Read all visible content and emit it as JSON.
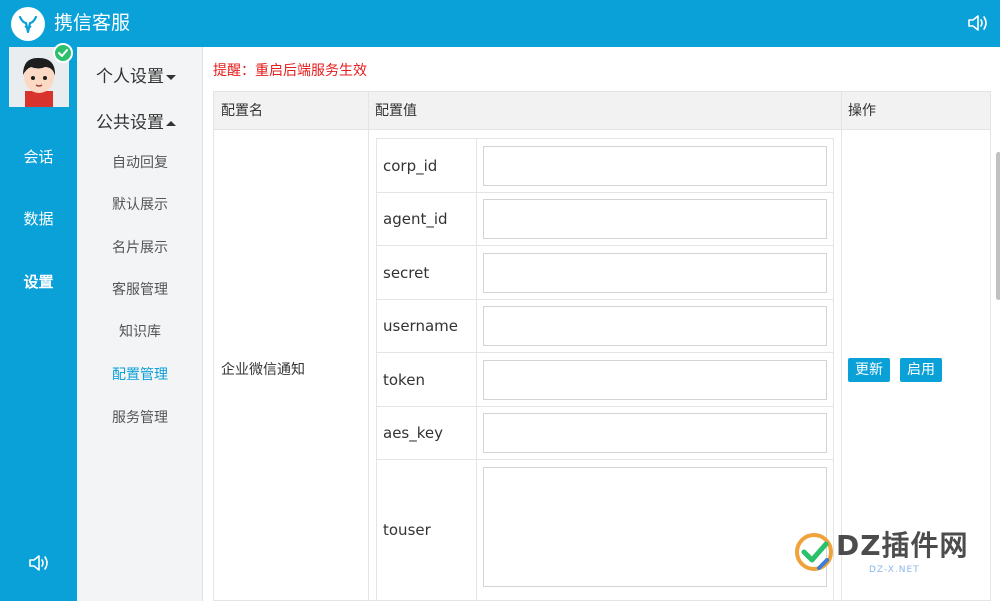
{
  "app": {
    "title": "携信客服"
  },
  "left_rail": {
    "items": [
      {
        "label": "会话"
      },
      {
        "label": "数据"
      },
      {
        "label": "设置"
      }
    ]
  },
  "submenu": {
    "group_personal": "个人设置",
    "group_public": "公共设置",
    "items": [
      {
        "label": "自动回复"
      },
      {
        "label": "默认展示"
      },
      {
        "label": "名片展示"
      },
      {
        "label": "客服管理"
      },
      {
        "label": "知识库"
      },
      {
        "label": "配置管理"
      },
      {
        "label": "服务管理"
      }
    ],
    "active": "配置管理"
  },
  "main": {
    "notice": "提醒：重启后端服务生效",
    "table": {
      "headers": [
        "配置名",
        "配置值",
        "操作"
      ],
      "row_name": "企业微信通知",
      "fields": [
        {
          "label": "corp_id",
          "value": ""
        },
        {
          "label": "agent_id",
          "value": ""
        },
        {
          "label": "secret",
          "value": ""
        },
        {
          "label": "username",
          "value": ""
        },
        {
          "label": "token",
          "value": ""
        },
        {
          "label": "aes_key",
          "value": ""
        },
        {
          "label": "touser",
          "value": ""
        }
      ],
      "actions": {
        "update": "更新",
        "enable": "启用"
      }
    }
  },
  "watermark": {
    "text": "DZ插件网",
    "sub": "DZ-X.NET"
  },
  "colors": {
    "accent": "#0aa0d8",
    "notice": "#e51d1d",
    "badge": "#2bc06b"
  },
  "icons": {
    "logo": "bull-logo-icon",
    "volume": "volume-icon",
    "check": "check-icon",
    "caret": "caret-icon"
  }
}
